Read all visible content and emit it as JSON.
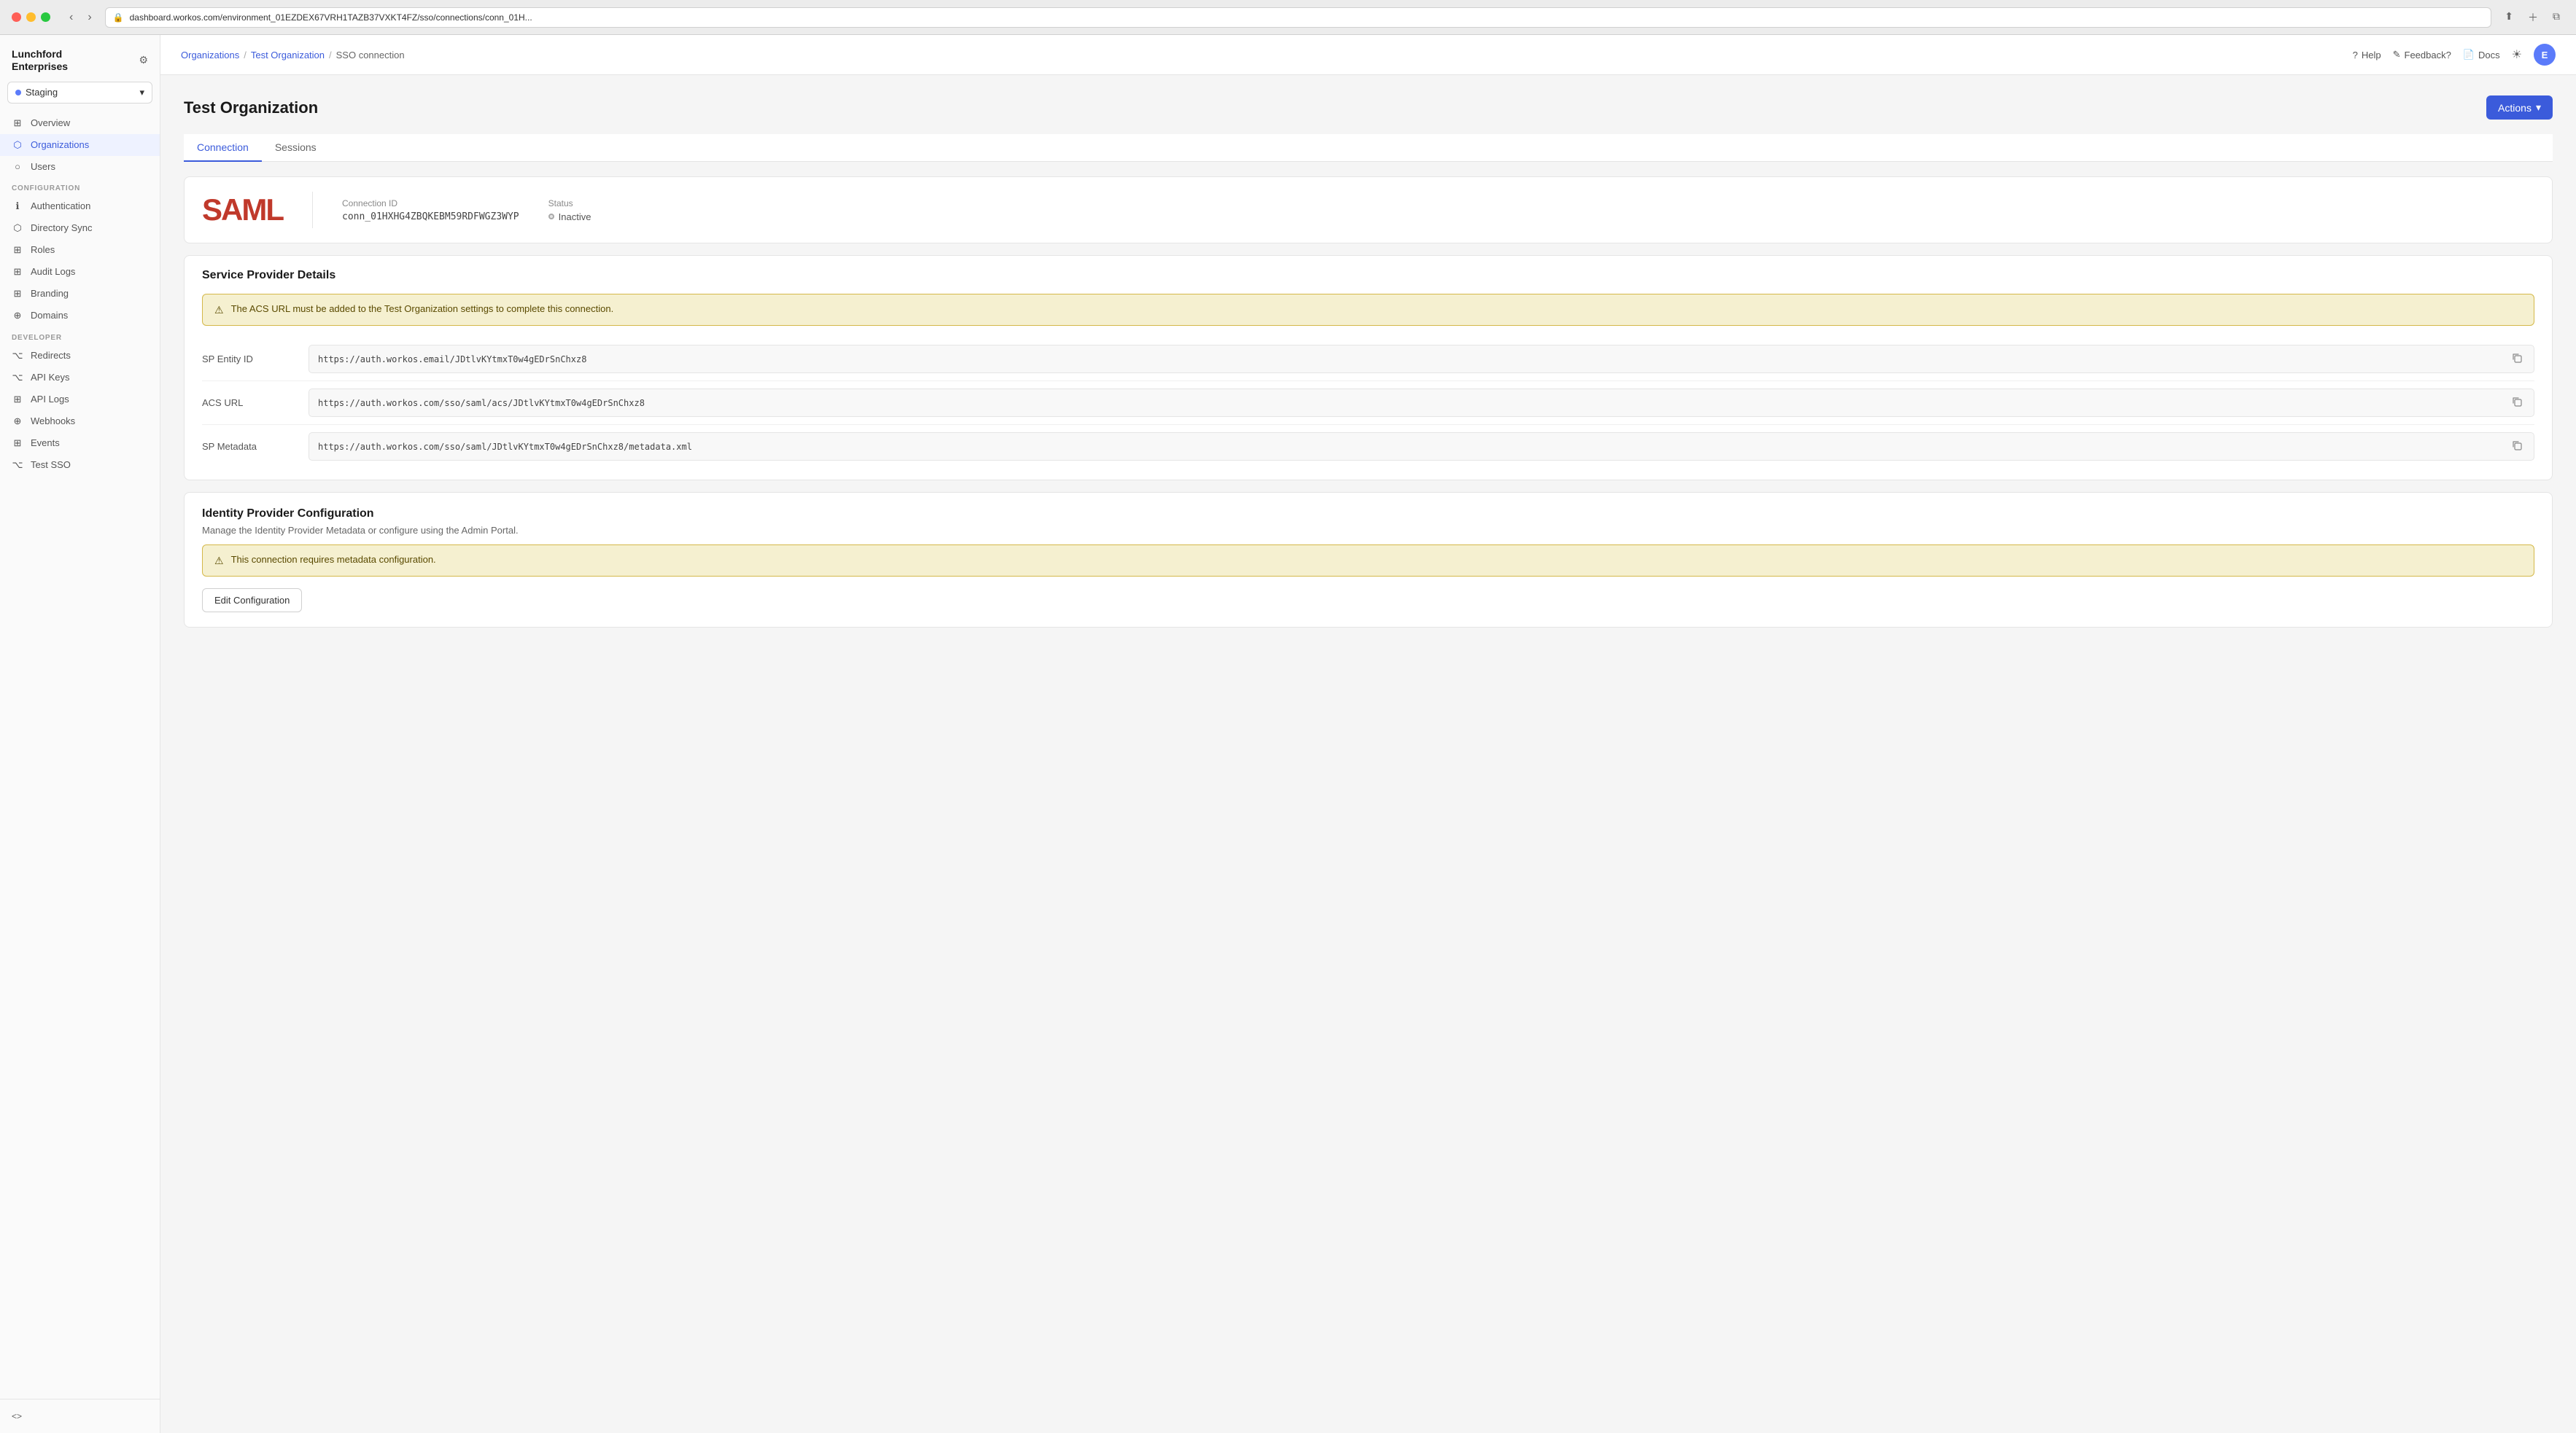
{
  "browser": {
    "url": "dashboard.workos.com/environment_01EZDEX67VRH1TAZB37VXKT4FZ/sso/connections/conn_01H...",
    "back_disabled": false,
    "forward_disabled": false
  },
  "sidebar": {
    "logo_line1": "Lunchford",
    "logo_line2": "Enterprises",
    "env_label": "Staging",
    "nav_top": [
      {
        "id": "overview",
        "label": "Overview",
        "icon": "⊞"
      },
      {
        "id": "organizations",
        "label": "Organizations",
        "icon": "⬡",
        "active": true
      },
      {
        "id": "users",
        "label": "Users",
        "icon": "○"
      }
    ],
    "section_config_label": "CONFIGURATION",
    "nav_config": [
      {
        "id": "authentication",
        "label": "Authentication",
        "icon": "ℹ"
      },
      {
        "id": "directory-sync",
        "label": "Directory Sync",
        "icon": "⬡"
      },
      {
        "id": "roles",
        "label": "Roles",
        "icon": "⊞"
      },
      {
        "id": "audit-logs",
        "label": "Audit Logs",
        "icon": "⊞"
      },
      {
        "id": "branding",
        "label": "Branding",
        "icon": "⊞"
      },
      {
        "id": "domains",
        "label": "Domains",
        "icon": "⊕"
      }
    ],
    "section_dev_label": "DEVELOPER",
    "nav_dev": [
      {
        "id": "redirects",
        "label": "Redirects",
        "icon": "⌥"
      },
      {
        "id": "api-keys",
        "label": "API Keys",
        "icon": "⌥"
      },
      {
        "id": "api-logs",
        "label": "API Logs",
        "icon": "⊞"
      },
      {
        "id": "webhooks",
        "label": "Webhooks",
        "icon": "⊕"
      },
      {
        "id": "events",
        "label": "Events",
        "icon": "⊞"
      },
      {
        "id": "test-sso",
        "label": "Test SSO",
        "icon": "⌥"
      }
    ],
    "bottom_icon": "<>"
  },
  "topbar": {
    "breadcrumb": [
      {
        "label": "Organizations",
        "link": true
      },
      {
        "label": "Test Organization",
        "link": true
      },
      {
        "label": "SSO connection",
        "link": false
      }
    ],
    "help_label": "Help",
    "feedback_label": "Feedback?",
    "docs_label": "Docs",
    "avatar_initials": "E"
  },
  "page": {
    "title": "Test Organization",
    "actions_label": "Actions",
    "tabs": [
      {
        "id": "connection",
        "label": "Connection",
        "active": true
      },
      {
        "id": "sessions",
        "label": "Sessions",
        "active": false
      }
    ]
  },
  "connection_card": {
    "type_label": "SAML",
    "connection_id_label": "Connection ID",
    "connection_id_value": "conn_01HXHG4ZBQKEBM59RDFWGZ3WYP",
    "status_label": "Status",
    "status_value": "Inactive"
  },
  "service_provider": {
    "title": "Service Provider Details",
    "warning": "The ACS URL must be added to the Test Organization settings to complete this connection.",
    "fields": [
      {
        "id": "sp-entity-id",
        "label": "SP Entity ID",
        "value": "https://auth.workos.email/JDtlvKYtmxT0w4gEDrSnChxz8"
      },
      {
        "id": "acs-url",
        "label": "ACS URL",
        "value": "https://auth.workos.com/sso/saml/acs/JDtlvKYtmxT0w4gEDrSnChxz8"
      },
      {
        "id": "sp-metadata",
        "label": "SP Metadata",
        "value": "https://auth.workos.com/sso/saml/JDtlvKYtmxT0w4gEDrSnChxz8/metadata.xml"
      }
    ]
  },
  "identity_provider": {
    "title": "Identity Provider Configuration",
    "subtitle": "Manage the Identity Provider Metadata or configure using the Admin Portal.",
    "warning": "This connection requires metadata configuration.",
    "edit_config_label": "Edit Configuration"
  }
}
